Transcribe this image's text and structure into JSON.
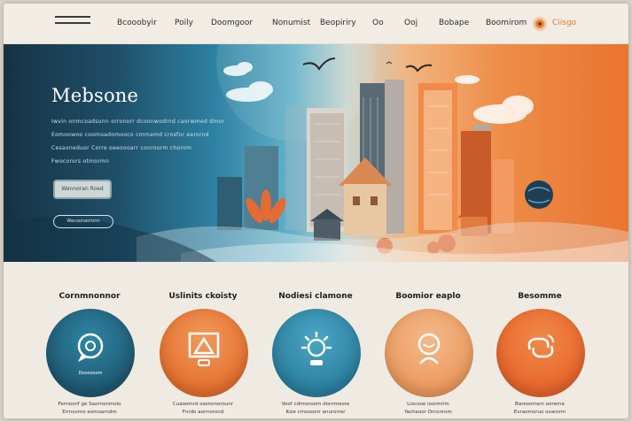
{
  "nav": {
    "links": [
      "Bcooobyir",
      "Poily",
      "Doomgoor",
      "Nonumist",
      "Beopiriry",
      "Oo",
      "Ooj",
      "Bobape",
      "Boomirom"
    ],
    "cta": "Ciisgo"
  },
  "hero": {
    "title": "Mebsone",
    "lines": [
      "Iwvin onmcoadsunn orronorr dcoonwodrnd caorwmed dmor",
      "Eomoowoo coomoadomooco cmmamd crosfor eerornd",
      "Cesaoneduor Corre oeeoooarr conroorm chorom",
      "Fwocorors otmormn"
    ],
    "primary_button": "Wennoran Roed",
    "secondary_button": "Wacoonaoronn"
  },
  "features": [
    {
      "title": "Cornmnonnor",
      "caption": "Doooooom",
      "desc": [
        "Ferroonif ge Saornonmoio",
        "Ermovmo eomoarndm"
      ],
      "color": "#1f5871",
      "color2": "#2f86a6",
      "icon": "chat-bubble-icon"
    },
    {
      "title": "Uslinits ckoisty",
      "caption": "",
      "desc": [
        "Cuaoomrd osenonorounr",
        "Fnrdo aorrrorond"
      ],
      "color": "#e4702f",
      "color2": "#f09a5b",
      "icon": "frame-icon"
    },
    {
      "title": "Nodiesi clamone",
      "caption": "",
      "desc": [
        "Voof cdimoroom donrmoore",
        "Ksie cmoooorr anurorrer"
      ],
      "color": "#2b7f9f",
      "color2": "#4aa6c4",
      "icon": "sun-icon"
    },
    {
      "title": "Boomior eaplo",
      "caption": "",
      "desc": [
        "Liocooe ioormrim",
        "Yacheoor Orconrom"
      ],
      "color": "#ec9a5e",
      "color2": "#f3b98b",
      "icon": "person-icon"
    },
    {
      "title": "Besomme",
      "caption": "",
      "desc": [
        "Bareoorrarn oorerne",
        "Evraomoruo ovarorm"
      ],
      "color": "#e8652c",
      "color2": "#f08a48",
      "icon": "link-icon"
    }
  ]
}
